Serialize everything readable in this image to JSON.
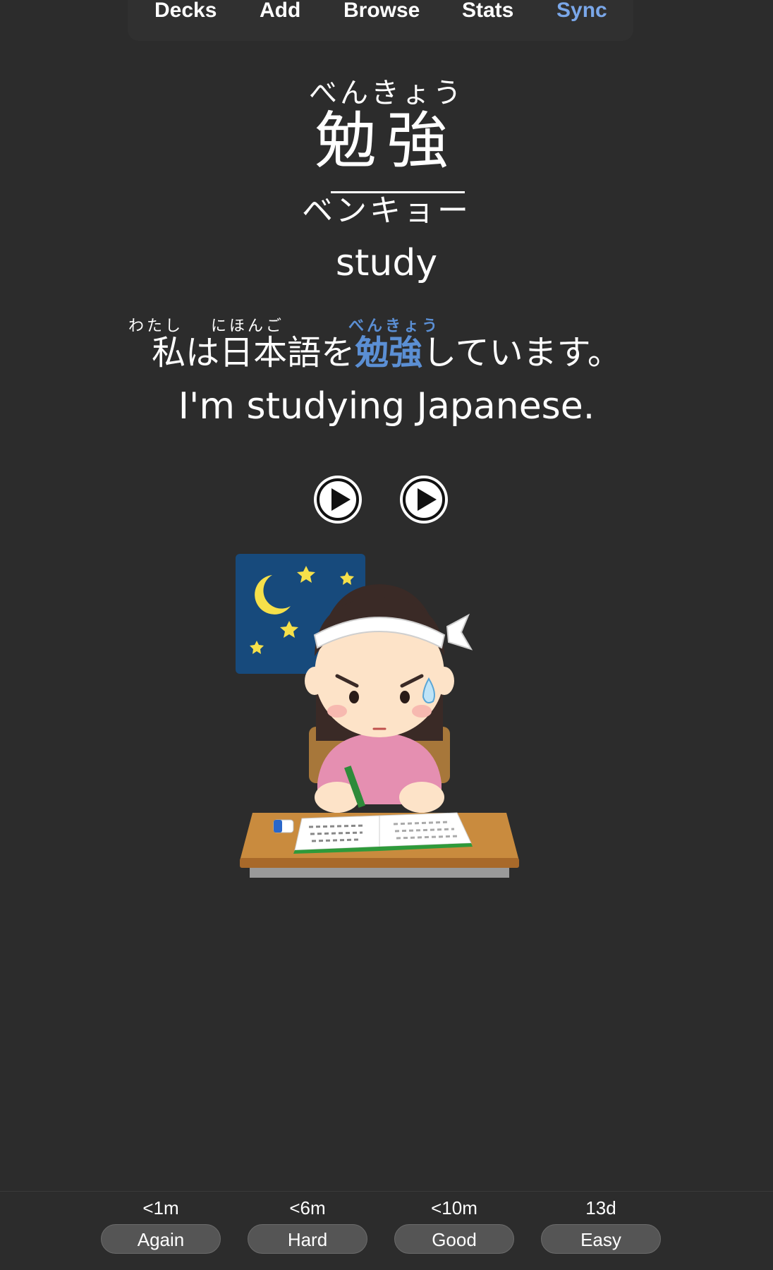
{
  "nav": {
    "items": [
      {
        "label": "Decks",
        "active": false
      },
      {
        "label": "Add",
        "active": false
      },
      {
        "label": "Browse",
        "active": false
      },
      {
        "label": "Stats",
        "active": false
      },
      {
        "label": "Sync",
        "active": true
      }
    ]
  },
  "card": {
    "word_furigana": "べんきょう",
    "word_kanji": "勉強",
    "word_reading": "ベンキョー",
    "meaning": "study",
    "sentence": {
      "furigana": {
        "watashi": "わたし",
        "nihongo": "にほんご",
        "benkyou": "べんきょう"
      },
      "part1": "私は日本語を",
      "highlight": "勉強",
      "part2": "しています。"
    },
    "translation": "I'm studying Japanese.",
    "audio_buttons": [
      "play-icon",
      "play-icon"
    ],
    "image": "girl-studying-at-desk-illustration"
  },
  "answers": [
    {
      "time": "<1m",
      "label": "Again"
    },
    {
      "time": "<6m",
      "label": "Hard"
    },
    {
      "time": "<10m",
      "label": "Good"
    },
    {
      "time": "13d",
      "label": "Easy"
    }
  ],
  "colors": {
    "background": "#2c2c2c",
    "accent": "#7aa7e9",
    "highlight": "#5b8fd4",
    "button": "#555555"
  }
}
